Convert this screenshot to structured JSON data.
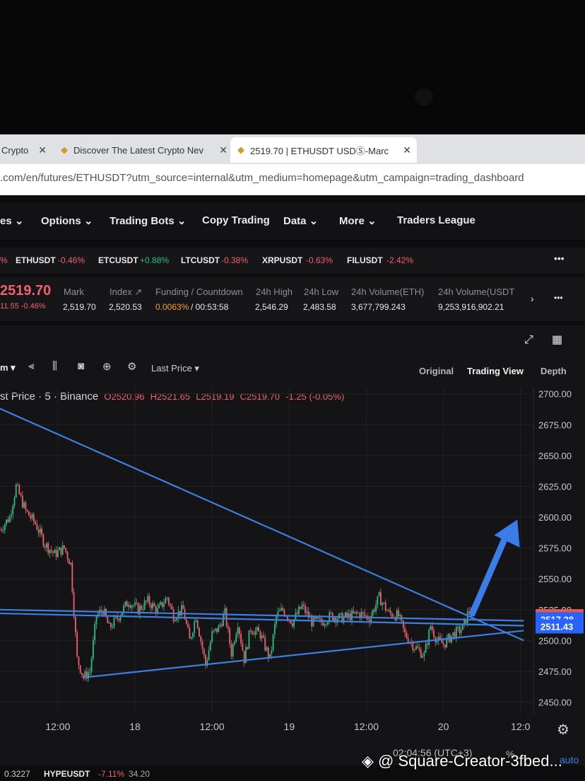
{
  "browser": {
    "tabs": [
      {
        "label": "Crypto",
        "active": false
      },
      {
        "label": "Discover The Latest Crypto Nev",
        "active": false
      },
      {
        "label": "2519.70 | ETHUSDT USDⓈ-Marc",
        "active": true
      }
    ],
    "url": ".com/en/futures/ETHUSDT?utm_source=internal&utm_medium=homepage&utm_campaign=trading_dashboard"
  },
  "nav": {
    "items": [
      "es ⌄",
      "Options ⌄",
      "Trading Bots ⌄",
      "Copy Trading",
      "Data ⌄",
      "More ⌄",
      "Traders League"
    ]
  },
  "ticker": {
    "items": [
      {
        "symbol": "%",
        "change": ""
      },
      {
        "symbol": "ETHUSDT",
        "change": "-0.46%"
      },
      {
        "symbol": "ETCUSDT",
        "change": "+0.88%"
      },
      {
        "symbol": "LTCUSDT",
        "change": "-0.38%"
      },
      {
        "symbol": "XRPUSDT",
        "change": "-0.63%"
      },
      {
        "symbol": "FILUSDT",
        "change": "-2.42%"
      }
    ]
  },
  "stats": {
    "price": "2519.70",
    "price_change": "11.55 -0.46%",
    "columns": [
      {
        "label": "Mark",
        "value": "2,519.70"
      },
      {
        "label": "Index ↗",
        "value": "2,520.53"
      },
      {
        "label": "Funding / Countdown",
        "value_a": "0.0063%",
        "value_b": "/ 00:53:58"
      },
      {
        "label": "24h High",
        "value": "2,546.29"
      },
      {
        "label": "24h Low",
        "value": "2,483.58"
      },
      {
        "label": "24h Volume(ETH)",
        "value": "3,677,799.243"
      },
      {
        "label": "24h Volume(USDT",
        "value": "9,253,916,902.21"
      }
    ]
  },
  "chart_toolbar": {
    "interval": "m ▾",
    "price_type": "Last Price ▾",
    "views": [
      "Original",
      "Trading View",
      "Depth"
    ],
    "active_view": "Trading View"
  },
  "chart_header": {
    "title": "st Price · 5 · Binance",
    "open": "O2520.96",
    "high": "H2521.65",
    "low": "L2519.19",
    "close": "C2519.70",
    "change": "-1.25 (-0.05%)"
  },
  "chart_data": {
    "type": "candlestick",
    "symbol": "ETHUSDT",
    "interval": "5",
    "exchange": "Binance",
    "y_ticks": [
      2700,
      2675,
      2650,
      2625,
      2600,
      2575,
      2550,
      2525,
      2500,
      2475,
      2450
    ],
    "y_tick_labels": [
      "2700.00",
      "2675.00",
      "2650.00",
      "2625.00",
      "2600.00",
      "2575.00",
      "2550.00",
      "2525.00",
      "2500.00",
      "2475.00",
      "2450.00"
    ],
    "ylim": [
      2440,
      2705
    ],
    "x_tick_labels": [
      "12:00",
      "18",
      "12:00",
      "19",
      "12:00",
      "20",
      "12:0"
    ],
    "x_tick_hours": [
      12,
      24,
      36,
      48,
      60,
      72,
      84
    ],
    "xlim": [
      3,
      86
    ],
    "price_path": [
      [
        3,
        2590
      ],
      [
        4.5,
        2600
      ],
      [
        5.5,
        2625
      ],
      [
        7,
        2605
      ],
      [
        8.5,
        2595
      ],
      [
        10,
        2578
      ],
      [
        11.5,
        2570
      ],
      [
        13,
        2575
      ],
      [
        14,
        2562
      ],
      [
        15,
        2485
      ],
      [
        16,
        2470
      ],
      [
        17,
        2475
      ],
      [
        18,
        2520
      ],
      [
        19,
        2525
      ],
      [
        20,
        2510
      ],
      [
        21.5,
        2520
      ],
      [
        23,
        2532
      ],
      [
        24.5,
        2525
      ],
      [
        26,
        2532
      ],
      [
        27.5,
        2524
      ],
      [
        29,
        2535
      ],
      [
        30,
        2520
      ],
      [
        31.5,
        2525
      ],
      [
        32.5,
        2500
      ],
      [
        33.5,
        2520
      ],
      [
        35,
        2480
      ],
      [
        36,
        2505
      ],
      [
        37,
        2510
      ],
      [
        38,
        2522
      ],
      [
        39,
        2490
      ],
      [
        40,
        2515
      ],
      [
        41,
        2485
      ],
      [
        42,
        2510
      ],
      [
        43.5,
        2505
      ],
      [
        45,
        2485
      ],
      [
        46,
        2520
      ],
      [
        47,
        2525
      ],
      [
        48.5,
        2515
      ],
      [
        50,
        2528
      ],
      [
        51.5,
        2515
      ],
      [
        53,
        2515
      ],
      [
        54.5,
        2520
      ],
      [
        56,
        2518
      ],
      [
        57.5,
        2520
      ],
      [
        59,
        2522
      ],
      [
        60.5,
        2518
      ],
      [
        62,
        2535
      ],
      [
        63.5,
        2522
      ],
      [
        65,
        2520
      ],
      [
        66,
        2505
      ],
      [
        67.5,
        2495
      ],
      [
        69,
        2488
      ],
      [
        70,
        2512
      ],
      [
        71,
        2500
      ],
      [
        72,
        2497
      ],
      [
        73.5,
        2505
      ],
      [
        75,
        2510
      ],
      [
        76,
        2525
      ],
      [
        76.5,
        2519.7
      ]
    ],
    "trendlines": [
      {
        "name": "descending",
        "from": [
          3,
          2688
        ],
        "to": [
          84.5,
          2500
        ]
      },
      {
        "name": "ascending",
        "from": [
          16,
          2470
        ],
        "to": [
          84.5,
          2508
        ]
      },
      {
        "name": "horizontal-1",
        "from": [
          3,
          2525
        ],
        "to": [
          84.5,
          2516
        ]
      },
      {
        "name": "horizontal-2",
        "from": [
          3,
          2522
        ],
        "to": [
          84.5,
          2512
        ]
      }
    ],
    "arrow": {
      "from": [
        76.5,
        2522
      ],
      "to": [
        83.5,
        2598
      ]
    },
    "price_labels": [
      {
        "value": "2519.70",
        "color": "#e8584c"
      },
      {
        "value": "2517.28",
        "color": "#2962ff"
      },
      {
        "value": "2511.43",
        "color": "#2962ff"
      }
    ],
    "colors": {
      "up": "#2ebd85",
      "down": "#f0616d",
      "lines": "#3d7fe0"
    },
    "grid": true
  },
  "status": {
    "clock": "02:04:56 (UTC+3)",
    "pct": "%",
    "auto": "auto"
  },
  "bottom_ticker": {
    "items": [
      "0.3227",
      "HYPEUSDT",
      "-7.11%",
      "34.20"
    ]
  },
  "watermark": {
    "text": "@ Square-Creator-3fbed..."
  }
}
